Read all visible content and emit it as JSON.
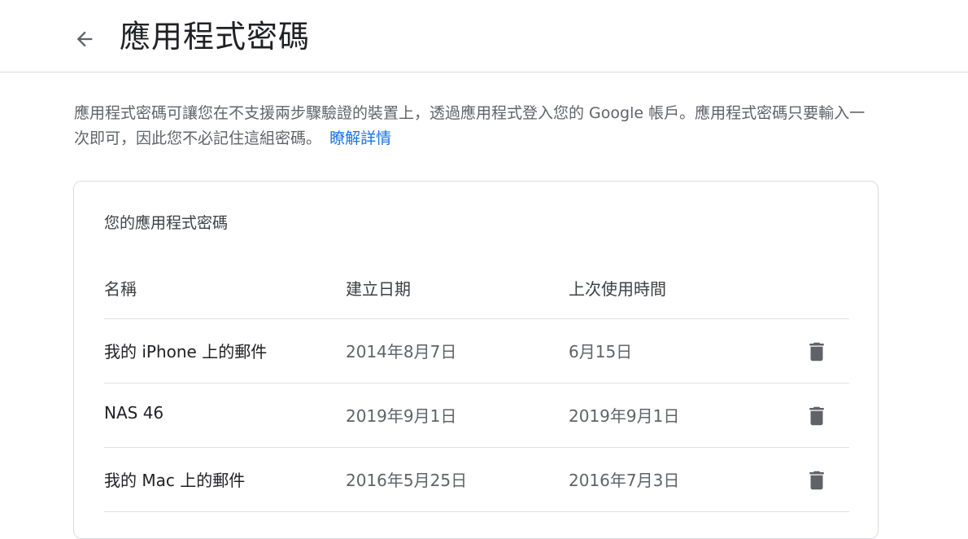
{
  "header": {
    "back_icon": "arrow-back-icon",
    "title": "應用程式密碼"
  },
  "intro": {
    "text": "應用程式密碼可讓您在不支援兩步驟驗證的裝置上，透過應用程式登入您的 Google 帳戶。應用程式密碼只要輸入一次即可，因此您不必記住這組密碼。",
    "learn_more": "瞭解詳情",
    "link_color": "#1a73e8"
  },
  "card": {
    "title": "您的應用程式密碼",
    "columns": {
      "name": "名稱",
      "created": "建立日期",
      "last_used": "上次使用時間"
    },
    "rows": [
      {
        "name": "我的 iPhone 上的郵件",
        "created": "2014年8月7日",
        "last_used": "6月15日",
        "action_icon": "trash-icon"
      },
      {
        "name": "NAS 46",
        "created": "2019年9月1日",
        "last_used": "2019年9月1日",
        "action_icon": "trash-icon"
      },
      {
        "name": "我的 Mac 上的郵件",
        "created": "2016年5月25日",
        "last_used": "2016年7月3日",
        "action_icon": "trash-icon"
      }
    ]
  }
}
